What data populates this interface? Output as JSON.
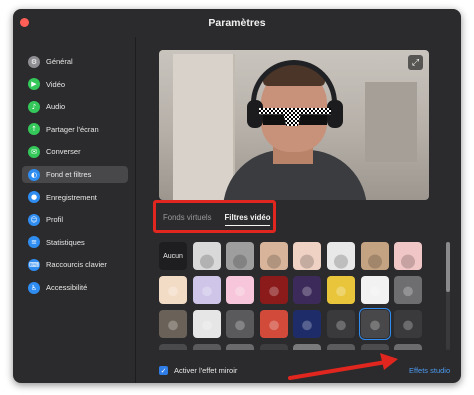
{
  "window": {
    "title": "Paramètres"
  },
  "sidebar": {
    "items": [
      {
        "label": "Général",
        "icon": "gear-icon",
        "glyph": "⚙",
        "color": "#8e8e93",
        "active": false
      },
      {
        "label": "Vidéo",
        "icon": "video-camera-icon",
        "glyph": "▶",
        "color": "#34c759",
        "active": false
      },
      {
        "label": "Audio",
        "icon": "headphones-icon",
        "glyph": "♪",
        "color": "#34c759",
        "active": false
      },
      {
        "label": "Partager l'écran",
        "icon": "share-screen-icon",
        "glyph": "↑",
        "color": "#34c759",
        "active": false
      },
      {
        "label": "Converser",
        "icon": "chat-icon",
        "glyph": "✉",
        "color": "#34c759",
        "active": false
      },
      {
        "label": "Fond et filtres",
        "icon": "background-filter-icon",
        "glyph": "◐",
        "color": "#2f8cf0",
        "active": true
      },
      {
        "label": "Enregistrement",
        "icon": "record-icon",
        "glyph": "●",
        "color": "#2f8cf0",
        "active": false
      },
      {
        "label": "Profil",
        "icon": "profile-icon",
        "glyph": "☺",
        "color": "#2f8cf0",
        "active": false
      },
      {
        "label": "Statistiques",
        "icon": "statistics-icon",
        "glyph": "≡",
        "color": "#2f8cf0",
        "active": false
      },
      {
        "label": "Raccourcis clavier",
        "icon": "keyboard-icon",
        "glyph": "⌨",
        "color": "#2f8cf0",
        "active": false
      },
      {
        "label": "Accessibilité",
        "icon": "accessibility-icon",
        "glyph": "♿",
        "color": "#2f8cf0",
        "active": false
      }
    ]
  },
  "preview": {
    "expand_icon": "expand-icon",
    "expand_glyph": "⤢"
  },
  "tabs": [
    {
      "label": "Fonds virtuels",
      "active": false
    },
    {
      "label": "Filtres vidéo",
      "active": true
    }
  ],
  "filters": {
    "none_label": "Aucun",
    "items": [
      {
        "kind": "none",
        "color": "#1e1e20"
      },
      {
        "kind": "tint",
        "color": "#d9d9d9"
      },
      {
        "kind": "tint",
        "color": "#9e9e9e"
      },
      {
        "kind": "tint",
        "color": "#d7b49a"
      },
      {
        "kind": "tint",
        "color": "#f0d2c4"
      },
      {
        "kind": "tint",
        "color": "#e8e8e8"
      },
      {
        "kind": "tint",
        "color": "#c4a382"
      },
      {
        "kind": "tint",
        "color": "#f1c6c6"
      },
      {
        "kind": "frame",
        "color": "#f3dcc6"
      },
      {
        "kind": "frame",
        "color": "#cfc5e8"
      },
      {
        "kind": "frame",
        "color": "#f7c6da"
      },
      {
        "kind": "frame",
        "color": "#8b1a1a"
      },
      {
        "kind": "frame",
        "color": "#3c2a5a"
      },
      {
        "kind": "frame",
        "color": "#e9c53c"
      },
      {
        "kind": "frame",
        "color": "#f2f2f2"
      },
      {
        "kind": "frame",
        "color": "#6e6e70"
      },
      {
        "kind": "frame",
        "color": "#6a6258"
      },
      {
        "kind": "frame",
        "color": "#e6e6e6"
      },
      {
        "kind": "frame",
        "color": "#5a5a5c"
      },
      {
        "kind": "frame",
        "color": "#d14a3a"
      },
      {
        "kind": "frame",
        "color": "#1e2c6a"
      },
      {
        "kind": "frame",
        "color": "#3a3a3c"
      },
      {
        "kind": "frame",
        "color": "#48484a",
        "selected": true
      },
      {
        "kind": "frame",
        "color": "#3a3a3c"
      },
      {
        "kind": "frame",
        "color": "#4a4a4c"
      },
      {
        "kind": "frame",
        "color": "#5a5a5c"
      },
      {
        "kind": "frame",
        "color": "#6a6a6c"
      },
      {
        "kind": "frame",
        "color": "#3e3e40"
      },
      {
        "kind": "frame",
        "color": "#7a7a7c"
      },
      {
        "kind": "frame",
        "color": "#5c5c5e"
      },
      {
        "kind": "frame",
        "color": "#4c4c4e"
      },
      {
        "kind": "frame",
        "color": "#6c6c6e"
      }
    ]
  },
  "mirror": {
    "label": "Activer l'effet miroir",
    "checked": true
  },
  "studio": {
    "label": "Effets studio"
  },
  "colors": {
    "annotation_red": "#e0261e",
    "link_blue": "#4a9af0",
    "accent_blue": "#2f7de6"
  }
}
